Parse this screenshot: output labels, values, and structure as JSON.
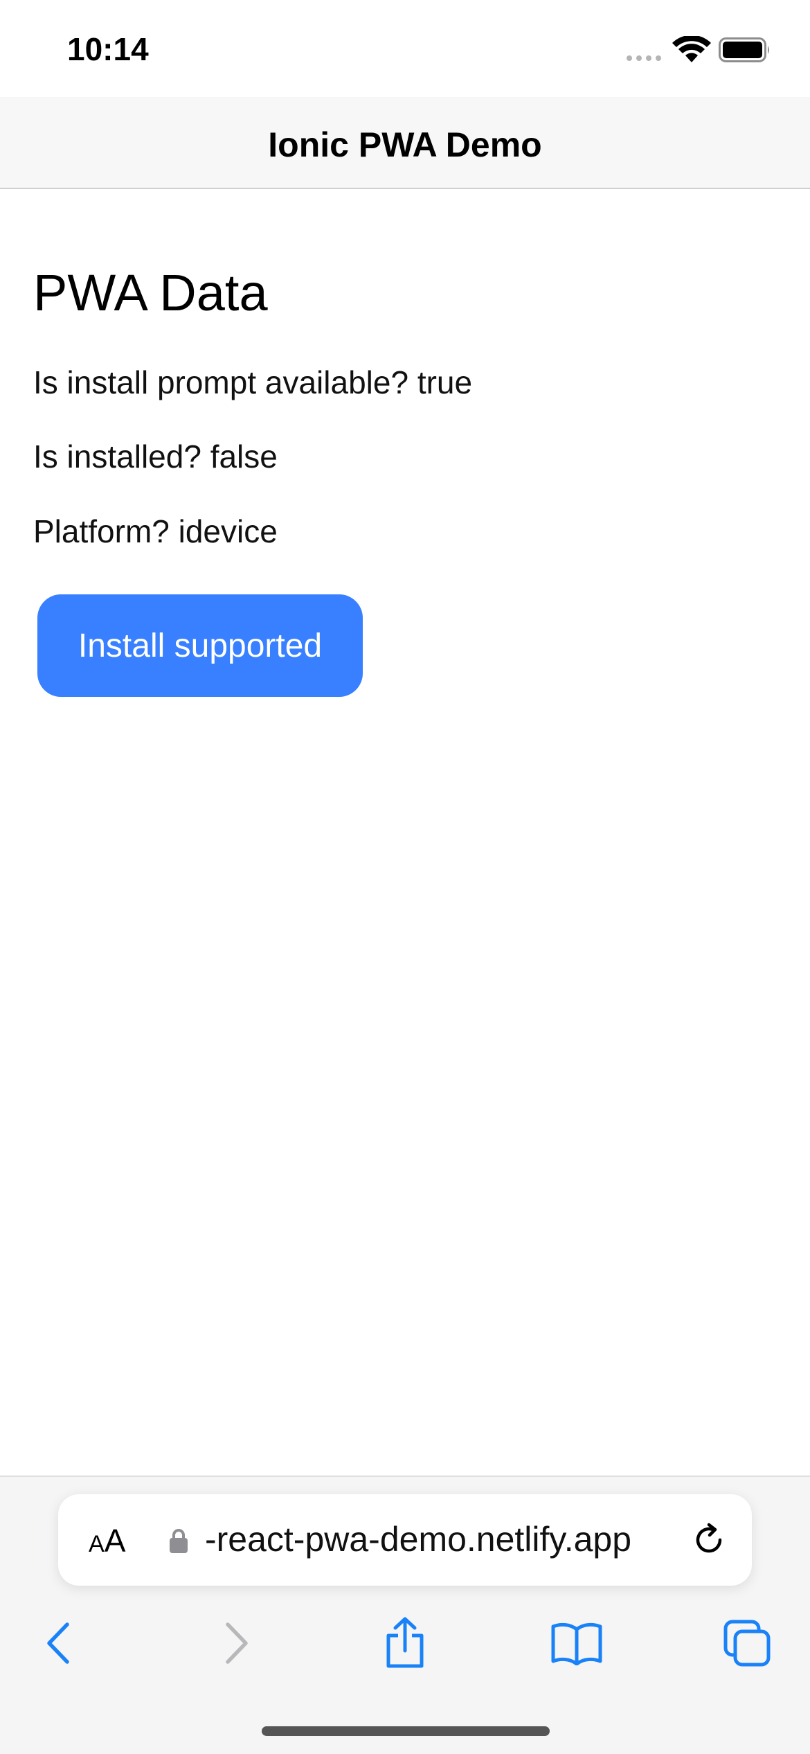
{
  "status_bar": {
    "time": "10:14",
    "icons": [
      "cellular-signal-icon",
      "wifi-icon",
      "battery-icon"
    ]
  },
  "header": {
    "title": "Ionic PWA Demo"
  },
  "main": {
    "section_title": "PWA Data",
    "lines": [
      "Is install prompt available? true",
      "Is installed? false",
      "Platform? idevice"
    ],
    "install_button_label": "Install supported"
  },
  "browser": {
    "text_size_label_small": "A",
    "text_size_label_large": "A",
    "url": "-react-pwa-demo.netlify.app",
    "toolbar_icons": [
      "back-icon",
      "forward-icon",
      "share-icon",
      "bookmarks-icon",
      "tabs-icon"
    ]
  },
  "colors": {
    "accent": "#3880ff",
    "safari_blue": "#1a82f7",
    "disabled_gray": "#b8b8bb",
    "header_bg": "#f7f7f7"
  }
}
